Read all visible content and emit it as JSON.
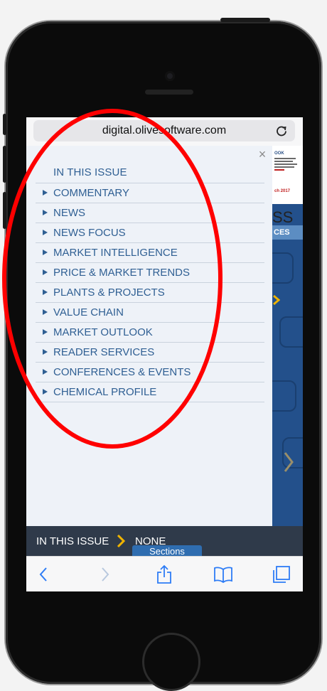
{
  "browser": {
    "url": "digital.olivesoftware.com"
  },
  "panel": {
    "heading": "IN THIS ISSUE",
    "close_glyph": "×",
    "items": [
      {
        "label": "COMMENTARY"
      },
      {
        "label": "NEWS"
      },
      {
        "label": "NEWS FOCUS"
      },
      {
        "label": "MARKET INTELLIGENCE"
      },
      {
        "label": "PRICE & MARKET TRENDS"
      },
      {
        "label": "PLANTS & PROJECTS"
      },
      {
        "label": "VALUE CHAIN"
      },
      {
        "label": "MARKET OUTLOOK"
      },
      {
        "label": "READER SERVICES"
      },
      {
        "label": "CONFERENCES & EVENTS"
      },
      {
        "label": "CHEMICAL PROFILE"
      }
    ]
  },
  "magazine": {
    "tiny_heading": "OOK",
    "date_text": "ch 2017",
    "title_fragment": "SS",
    "band_text": "CES"
  },
  "footer": {
    "label": "IN THIS ISSUE",
    "value": "NONE",
    "sections_tab": "Sections"
  },
  "toolbar": {
    "back_icon": "chevron-left-icon",
    "forward_icon": "chevron-right-icon",
    "share_icon": "share-icon",
    "bookmarks_icon": "book-icon",
    "tabs_icon": "tabs-icon"
  },
  "colors": {
    "menu_text": "#2f5f93",
    "footer_bg": "#2f3a4a",
    "annotation": "#ff0000",
    "sections_tab_bg": "#2f6db0"
  }
}
